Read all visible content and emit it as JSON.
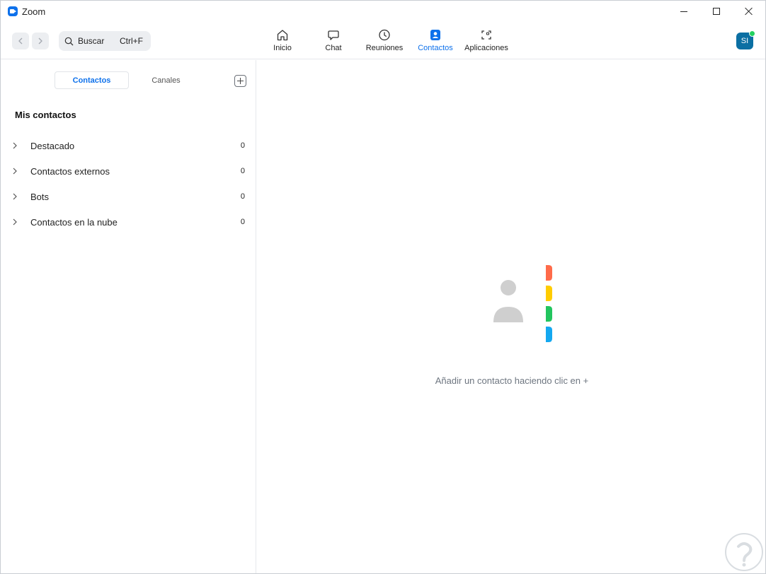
{
  "window": {
    "title": "Zoom",
    "controls": [
      "minimize-icon",
      "maximize-icon",
      "close-icon"
    ]
  },
  "toolbar": {
    "search": {
      "label": "Buscar",
      "shortcut": "Ctrl+F"
    },
    "tabs": [
      {
        "label": "Inicio",
        "icon": "home-icon",
        "active": false
      },
      {
        "label": "Chat",
        "icon": "chat-bubble-icon",
        "active": false
      },
      {
        "label": "Reuniones",
        "icon": "clock-icon",
        "active": false
      },
      {
        "label": "Contactos",
        "icon": "contact-card-icon",
        "active": true
      },
      {
        "label": "Aplicaciones",
        "icon": "apps-icon",
        "active": false
      }
    ],
    "avatar": {
      "initials": "SI",
      "presence_color": "#23d160"
    }
  },
  "contacts_panel": {
    "segments": [
      {
        "label": "Contactos",
        "active": true
      },
      {
        "label": "Canales",
        "active": false
      }
    ],
    "section_title": "Mis contactos",
    "groups": [
      {
        "label": "Destacado",
        "count": "0"
      },
      {
        "label": "Contactos externos",
        "count": "0"
      },
      {
        "label": "Bots",
        "count": "0"
      },
      {
        "label": "Contactos en la nube",
        "count": "0"
      }
    ]
  },
  "empty_state": {
    "message": "Añadir un contacto haciendo clic en +",
    "tab_colors": [
      "#ff6b4a",
      "#ffcc00",
      "#22c55e",
      "#14a8f0"
    ]
  },
  "colors": {
    "accent": "#0e71eb",
    "avatar_bg": "#0b6fa3"
  }
}
